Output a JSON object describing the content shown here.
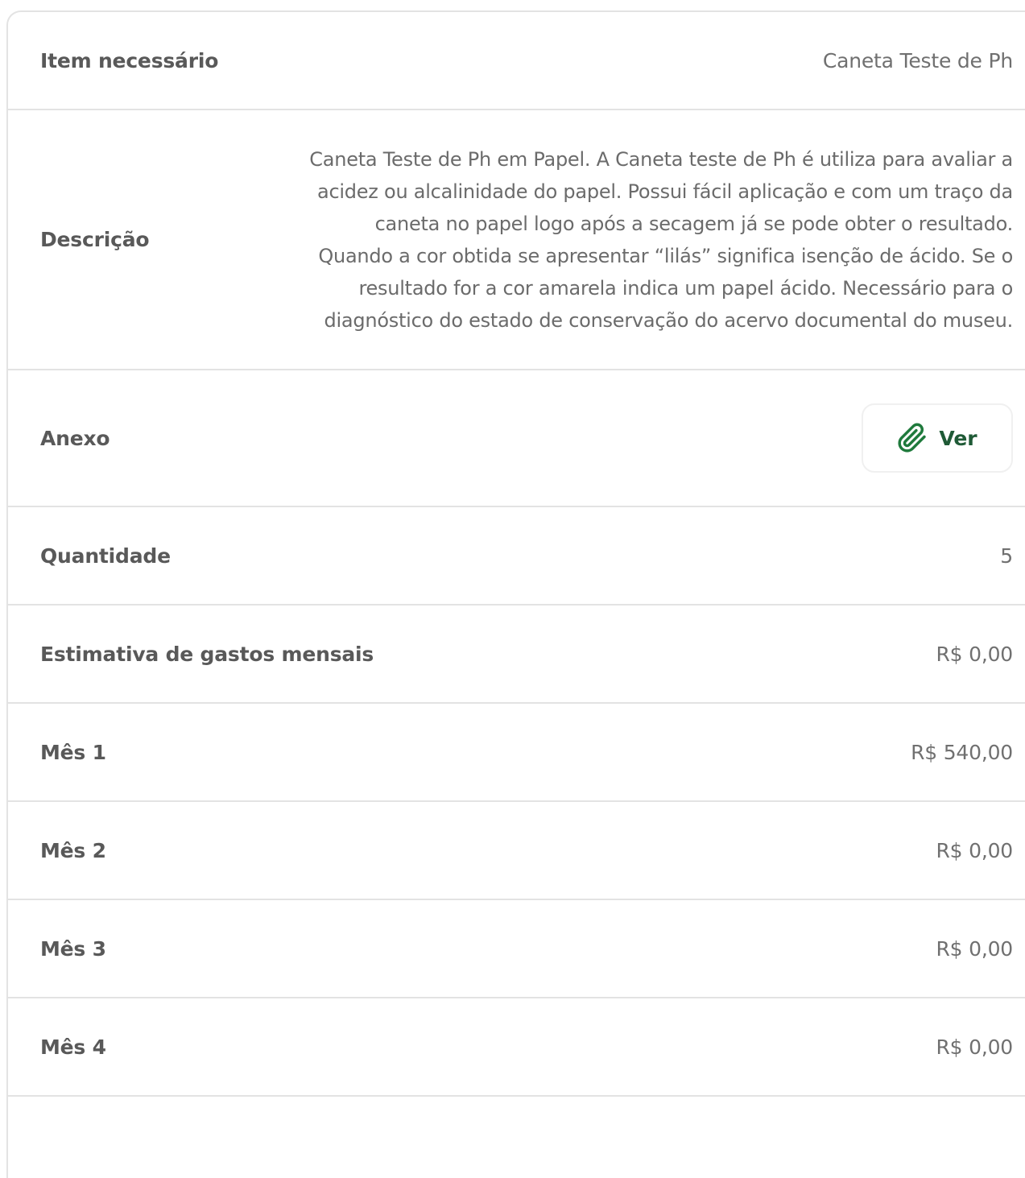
{
  "rows": {
    "item": {
      "label": "Item necessário",
      "value": "Caneta Teste de Ph"
    },
    "descricao": {
      "label": "Descrição",
      "lines": [
        "Caneta Teste de Ph em Papel. A Caneta teste de Ph é utiliza para avaliar a",
        "acidez ou alcalinidade do papel. Possui fácil aplicação e com um traço da",
        "caneta no papel logo após a secagem já se pode obter o resultado.",
        "Quando a cor obtida se apresentar “lilás” significa isenção de ácido. Se o",
        "resultado for a cor amarela indica um papel ácido. Necessário para o",
        "diagnóstico do estado de conservação do acervo documental do museu."
      ]
    },
    "anexo": {
      "label": "Anexo",
      "button_label": "Ver",
      "button_icon": "paperclip-icon"
    },
    "quantidade": {
      "label": "Quantidade",
      "value": "5"
    },
    "estimativa": {
      "label": "Estimativa de gastos mensais",
      "value": "R$ 0,00"
    },
    "mes1": {
      "label": "Mês 1",
      "value": "R$ 540,00"
    },
    "mes2": {
      "label": "Mês 2",
      "value": "R$ 0,00"
    },
    "mes3": {
      "label": "Mês 3",
      "value": "R$ 0,00"
    },
    "mes4": {
      "label": "Mês 4",
      "value": "R$ 0,00"
    }
  },
  "colors": {
    "accent": "#1f7a3c",
    "label_text": "#595959",
    "value_text": "#707070",
    "divider": "#e3e3e3"
  }
}
